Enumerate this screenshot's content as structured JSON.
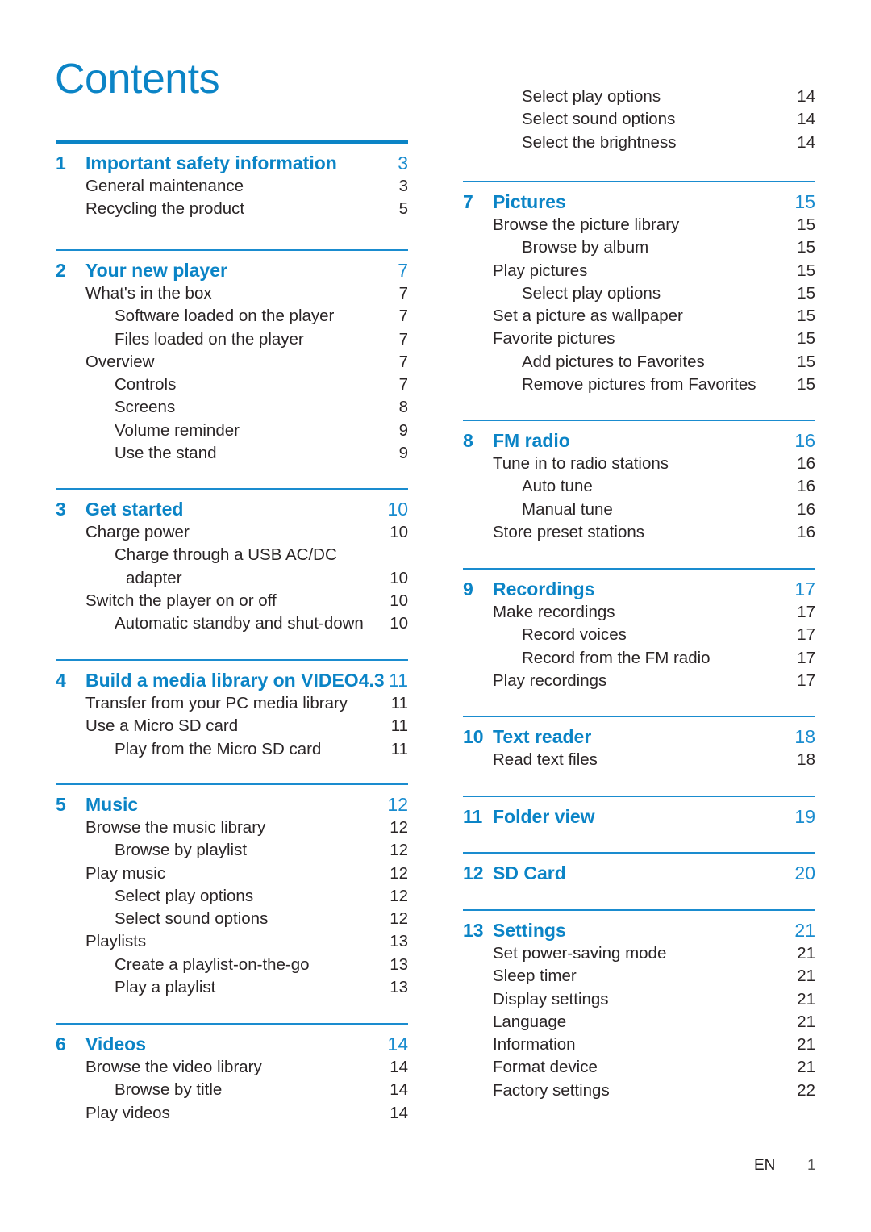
{
  "page": {
    "title": "Contents",
    "accent_color": "#0b84c6",
    "footer": {
      "lang": "EN",
      "page_number": "1"
    }
  },
  "left": {
    "sections": [
      {
        "num": "1",
        "title": "Important safety information",
        "page": "3",
        "entries": [
          {
            "level": 2,
            "text": "General maintenance",
            "page": "3"
          },
          {
            "level": 2,
            "text": "Recycling the product",
            "page": "5"
          }
        ]
      },
      {
        "num": "2",
        "title": "Your new player",
        "page": "7",
        "entries": [
          {
            "level": 2,
            "text": "What's in the box",
            "page": "7"
          },
          {
            "level": 3,
            "text": "Software loaded on the player",
            "page": "7"
          },
          {
            "level": 3,
            "text": "Files loaded on the player",
            "page": "7"
          },
          {
            "level": 2,
            "text": "Overview",
            "page": "7"
          },
          {
            "level": 3,
            "text": "Controls",
            "page": "7"
          },
          {
            "level": 3,
            "text": "Screens",
            "page": "8"
          },
          {
            "level": 3,
            "text": "Volume reminder",
            "page": "9"
          },
          {
            "level": 3,
            "text": "Use the stand",
            "page": "9"
          }
        ]
      },
      {
        "num": "3",
        "title": "Get started",
        "page": "10",
        "entries": [
          {
            "level": 2,
            "text": "Charge power",
            "page": "10"
          },
          {
            "level": 3,
            "text": "Charge through a USB AC/DC",
            "page": ""
          },
          {
            "level": "3b",
            "text": "adapter",
            "page": "10"
          },
          {
            "level": 2,
            "text": "Switch the player on or off",
            "page": "10"
          },
          {
            "level": 3,
            "text": "Automatic standby and shut-down",
            "page": "10"
          }
        ]
      },
      {
        "num": "4",
        "title": "Build a media library on VIDEO4.3",
        "page": "11",
        "entries": [
          {
            "level": 2,
            "text": "Transfer from your PC media library",
            "page": "11"
          },
          {
            "level": 2,
            "text": "Use a Micro SD card",
            "page": "11"
          },
          {
            "level": 3,
            "text": "Play from the Micro SD card",
            "page": "11"
          }
        ]
      },
      {
        "num": "5",
        "title": "Music",
        "page": "12",
        "entries": [
          {
            "level": 2,
            "text": "Browse the music library",
            "page": "12"
          },
          {
            "level": 3,
            "text": "Browse by playlist",
            "page": "12"
          },
          {
            "level": 2,
            "text": "Play music",
            "page": "12"
          },
          {
            "level": 3,
            "text": "Select play options",
            "page": "12"
          },
          {
            "level": 3,
            "text": "Select sound options",
            "page": "12"
          },
          {
            "level": 2,
            "text": "Playlists",
            "page": "13"
          },
          {
            "level": 3,
            "text": "Create a playlist-on-the-go",
            "page": "13"
          },
          {
            "level": 3,
            "text": "Play a playlist",
            "page": "13"
          }
        ]
      },
      {
        "num": "6",
        "title": "Videos",
        "page": "14",
        "entries": [
          {
            "level": 2,
            "text": "Browse the video library",
            "page": "14"
          },
          {
            "level": 3,
            "text": "Browse by title",
            "page": "14"
          },
          {
            "level": 2,
            "text": "Play videos",
            "page": "14"
          }
        ]
      }
    ]
  },
  "right": {
    "continued": [
      {
        "level": 3,
        "text": "Select play options",
        "page": "14"
      },
      {
        "level": 3,
        "text": "Select sound options",
        "page": "14"
      },
      {
        "level": 3,
        "text": "Select the brightness",
        "page": "14"
      }
    ],
    "sections": [
      {
        "num": "7",
        "title": "Pictures",
        "page": "15",
        "entries": [
          {
            "level": 2,
            "text": "Browse the picture library",
            "page": "15"
          },
          {
            "level": 3,
            "text": "Browse by album",
            "page": "15"
          },
          {
            "level": 2,
            "text": "Play pictures",
            "page": "15"
          },
          {
            "level": 3,
            "text": "Select play options",
            "page": "15"
          },
          {
            "level": 2,
            "text": "Set a picture as wallpaper",
            "page": "15"
          },
          {
            "level": 2,
            "text": "Favorite pictures",
            "page": "15"
          },
          {
            "level": 3,
            "text": "Add pictures to Favorites",
            "page": "15"
          },
          {
            "level": 3,
            "text": "Remove pictures from Favorites",
            "page": "15"
          }
        ]
      },
      {
        "num": "8",
        "title": "FM radio",
        "page": "16",
        "entries": [
          {
            "level": 2,
            "text": "Tune in to radio stations",
            "page": "16"
          },
          {
            "level": 3,
            "text": "Auto tune",
            "page": "16"
          },
          {
            "level": 3,
            "text": "Manual tune",
            "page": "16"
          },
          {
            "level": 2,
            "text": "Store preset stations",
            "page": "16"
          }
        ]
      },
      {
        "num": "9",
        "title": "Recordings",
        "page": "17",
        "entries": [
          {
            "level": 2,
            "text": "Make recordings",
            "page": "17"
          },
          {
            "level": 3,
            "text": "Record voices",
            "page": "17"
          },
          {
            "level": 3,
            "text": "Record from the FM radio",
            "page": "17"
          },
          {
            "level": 2,
            "text": "Play recordings",
            "page": "17"
          }
        ]
      },
      {
        "num": "10",
        "title": "Text reader",
        "page": "18",
        "entries": [
          {
            "level": 2,
            "text": "Read text files",
            "page": "18"
          }
        ]
      },
      {
        "num": "11",
        "title": "Folder view",
        "page": "19",
        "entries": []
      },
      {
        "num": "12",
        "title": "SD Card",
        "page": "20",
        "entries": []
      },
      {
        "num": "13",
        "title": "Settings",
        "page": "21",
        "entries": [
          {
            "level": 2,
            "text": "Set power-saving mode",
            "page": "21"
          },
          {
            "level": 2,
            "text": "Sleep timer",
            "page": "21"
          },
          {
            "level": 2,
            "text": "Display settings",
            "page": "21"
          },
          {
            "level": 2,
            "text": "Language",
            "page": "21"
          },
          {
            "level": 2,
            "text": "Information",
            "page": "21"
          },
          {
            "level": 2,
            "text": "Format device",
            "page": "21"
          },
          {
            "level": 2,
            "text": "Factory settings",
            "page": "22"
          }
        ]
      }
    ]
  }
}
